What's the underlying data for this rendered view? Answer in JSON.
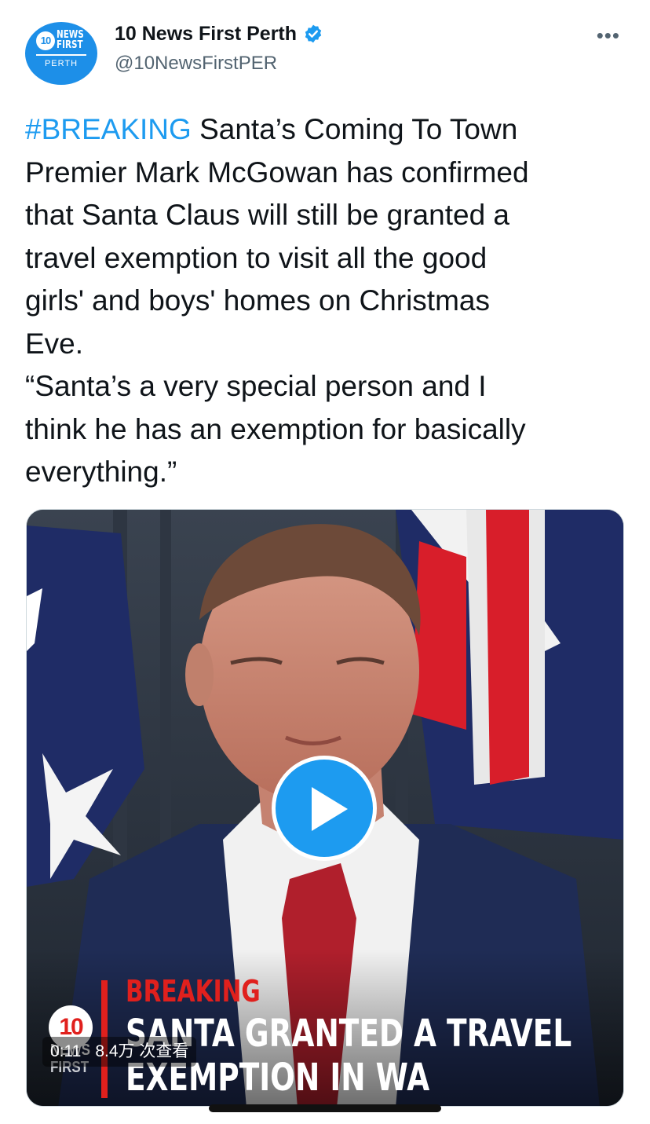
{
  "account": {
    "display_name": "10 News First Perth",
    "handle": "@10NewsFirstPER",
    "verified": true,
    "avatar": {
      "logo_number": "10",
      "logo_word1": "NEWS",
      "logo_word2": "FIRST",
      "logo_sub": "PERTH"
    }
  },
  "more_label": "•••",
  "tweet": {
    "hashtag": "#BREAKING",
    "lines": [
      " Santa’s Coming To Town",
      "Premier Mark McGowan has confirmed",
      "that Santa Claus will still be granted a",
      "travel exemption to visit all the good",
      "girls' and boys' homes on Christmas",
      "Eve.",
      "“Santa’s a very special person and I",
      "think he has an exemption for basically",
      "everything.”"
    ]
  },
  "video": {
    "overlay": {
      "breaking": "BREAKING",
      "headline_line1": "SANTA GRANTED A TRAVEL",
      "headline_line2": "EXEMPTION IN WA",
      "channel_number": "10",
      "channel_word1": "NEWS",
      "channel_word2": "FIRST"
    },
    "duration": "0:11",
    "views": "8.4万 次查看"
  },
  "colors": {
    "accent": "#1d9bf0",
    "text": "#0f1419",
    "secondary_text": "#536471",
    "breaking_red": "#e0201d"
  },
  "icons": [
    "verified-badge-icon",
    "more-options-icon",
    "play-icon"
  ]
}
